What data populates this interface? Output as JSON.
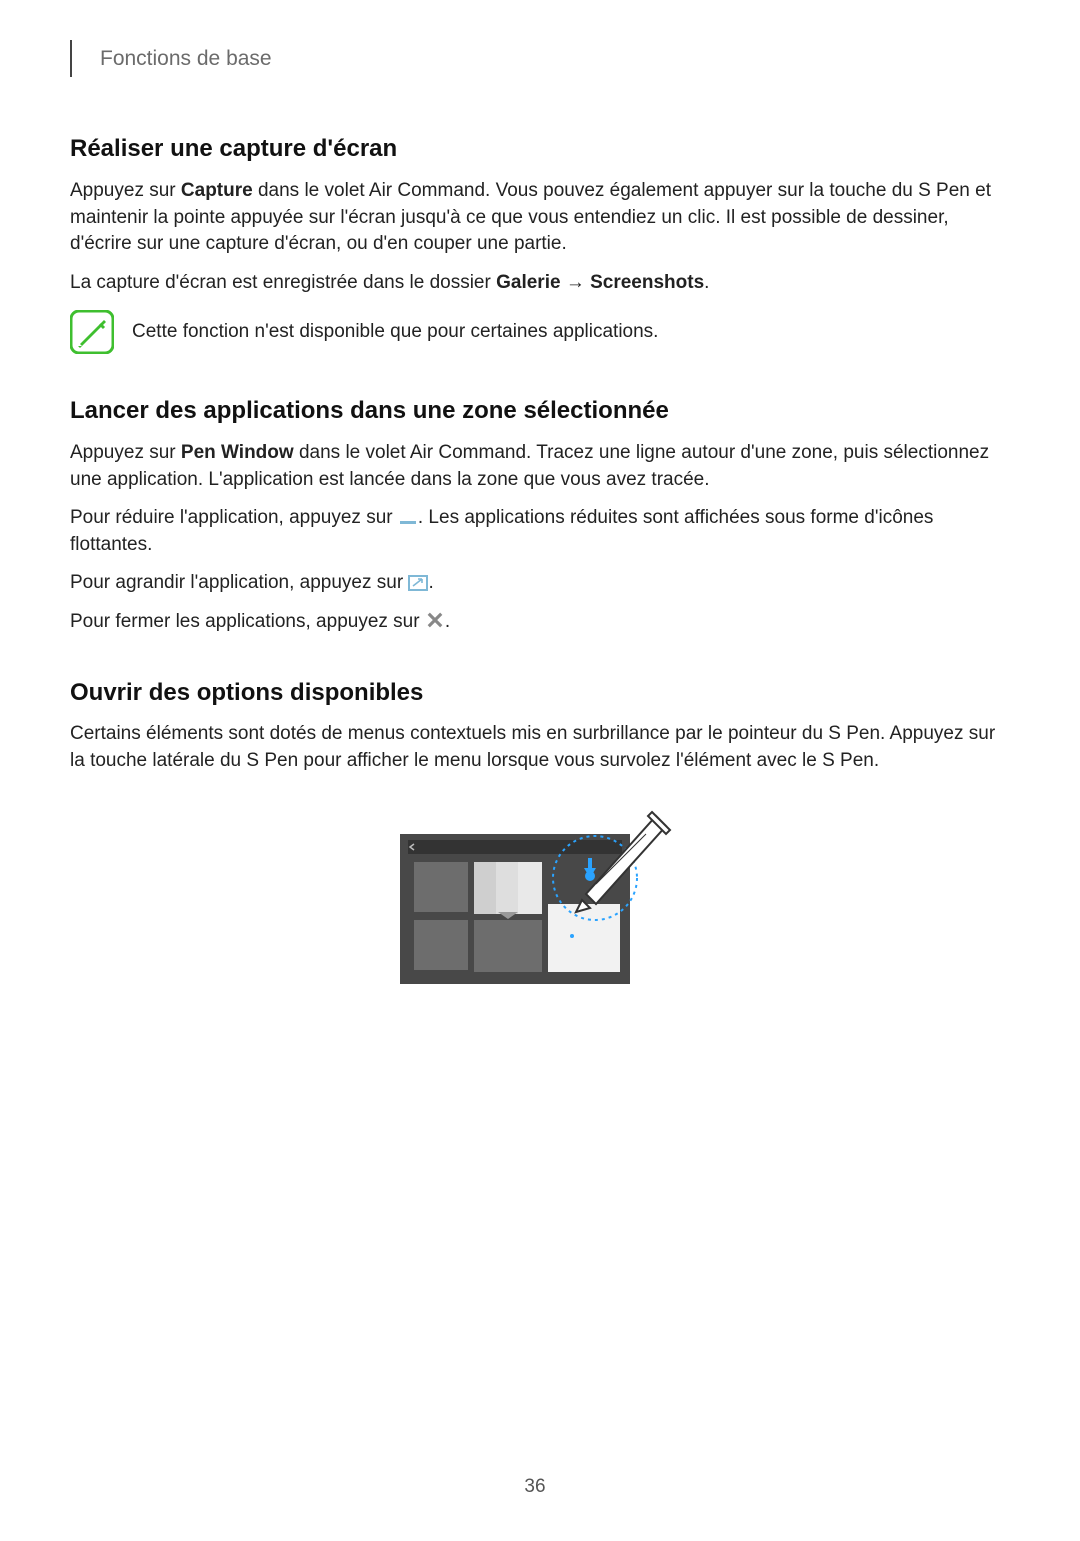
{
  "header": {
    "breadcrumb": "Fonctions de base"
  },
  "section1": {
    "title": "Réaliser une capture d'écran",
    "p1_a": "Appuyez sur ",
    "p1_bold": "Capture",
    "p1_b": " dans le volet Air Command. Vous pouvez également appuyer sur la touche du S Pen et maintenir la pointe appuyée sur l'écran jusqu'à ce que vous entendiez un clic. Il est possible de dessiner, d'écrire sur une capture d'écran, ou d'en couper une partie.",
    "p2_a": "La capture d'écran est enregistrée dans le dossier ",
    "p2_bold1": "Galerie",
    "p2_arrow": " → ",
    "p2_bold2": "Screenshots",
    "p2_b": ".",
    "note": "Cette fonction n'est disponible que pour certaines applications."
  },
  "section2": {
    "title": "Lancer des applications dans une zone sélectionnée",
    "p1_a": "Appuyez sur ",
    "p1_bold": "Pen Window",
    "p1_b": " dans le volet Air Command. Tracez une ligne autour d'une zone, puis sélectionnez une application. L'application est lancée dans la zone que vous avez tracée.",
    "p2_a": "Pour réduire l'application, appuyez sur ",
    "p2_b": ". Les applications réduites sont affichées sous forme d'icônes flottantes.",
    "p3_a": "Pour agrandir l'application, appuyez sur ",
    "p3_b": ".",
    "p4_a": "Pour fermer les applications, appuyez sur ",
    "p4_b": "."
  },
  "section3": {
    "title": "Ouvrir des options disponibles",
    "p1": "Certains éléments sont dotés de menus contextuels mis en surbrillance par le pointeur du S Pen. Appuyez sur la touche latérale du S Pen pour afficher le menu lorsque vous survolez l'élément avec le S Pen."
  },
  "page": {
    "number": "36"
  }
}
